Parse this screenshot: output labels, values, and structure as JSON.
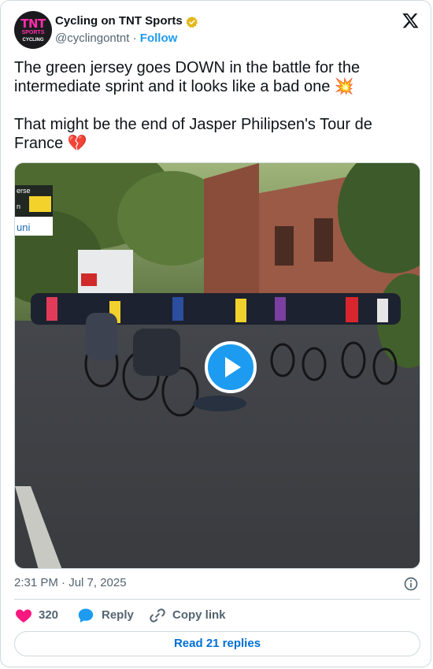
{
  "account": {
    "name": "Cycling on TNT Sports",
    "handle": "@cyclingontnt",
    "separator": "·",
    "follow_label": "Follow",
    "avatar_text": {
      "line1": "TNT",
      "line2": "SPORTS",
      "line3": "CYCLING"
    },
    "verified_icon": "verified-gold-badge-icon"
  },
  "tweet": {
    "text": "The green jersey goes DOWN in the battle for the intermediate sprint and it looks like a bad one 💥\n\nThat might be the end of Jasper Philipsen's Tour de France 💔",
    "timestamp": "2:31 PM · Jul 7, 2025"
  },
  "media": {
    "type": "video",
    "play_icon": "play-icon",
    "overlay_text": [
      "erse",
      "n",
      "uni"
    ]
  },
  "actions": {
    "like_count": "320",
    "reply_label": "Reply",
    "copy_label": "Copy link"
  },
  "footer": {
    "read_replies_label": "Read 21 replies"
  },
  "colors": {
    "accent": "#1d9bf0",
    "like": "#f91880",
    "secondary_text": "#536471",
    "border": "#cfd9de"
  }
}
